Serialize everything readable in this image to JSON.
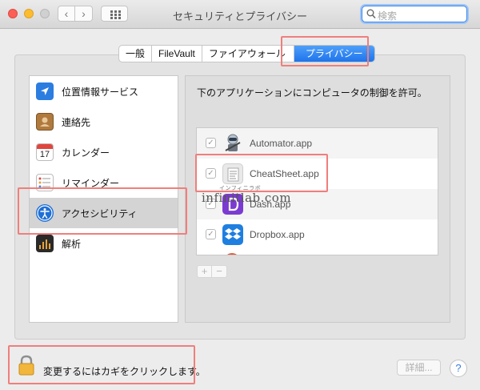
{
  "window": {
    "title": "セキュリティとプライバシー",
    "search_placeholder": "検索",
    "nav_back": "‹",
    "nav_forward": "›"
  },
  "tabs": [
    {
      "label": "一般",
      "active": false
    },
    {
      "label": "FileVault",
      "active": false
    },
    {
      "label": "ファイアウォール",
      "active": false
    },
    {
      "label": "プライバシー",
      "active": true
    }
  ],
  "sidebar": {
    "items": [
      {
        "label": "位置情報サービス",
        "icon": "location-arrow-icon",
        "selected": false
      },
      {
        "label": "連絡先",
        "icon": "contacts-book-icon",
        "selected": false
      },
      {
        "label": "カレンダー",
        "icon": "calendar-icon",
        "selected": false,
        "icon_day": "17"
      },
      {
        "label": "リマインダー",
        "icon": "reminders-icon",
        "selected": false
      },
      {
        "label": "アクセシビリティ",
        "icon": "accessibility-icon",
        "selected": true
      },
      {
        "label": "解析",
        "icon": "analytics-icon",
        "selected": false
      }
    ]
  },
  "main": {
    "description": "下のアプリケーションにコンピュータの制御を許可。",
    "apps": [
      {
        "name": "Automator.app",
        "checked": true,
        "icon": "automator-robot-icon"
      },
      {
        "name": "CheatSheet.app",
        "checked": true,
        "icon": "cheatsheet-icon"
      },
      {
        "name": "Dash.app",
        "checked": true,
        "icon": "dash-icon"
      },
      {
        "name": "Dropbox.app",
        "checked": true,
        "icon": "dropbox-icon"
      }
    ],
    "add_label": "+",
    "remove_label": "−",
    "checkmark": "✓"
  },
  "footer": {
    "lock_text": "変更するにはカギをクリックします。",
    "details_label": "詳細...",
    "help_label": "?"
  },
  "watermark": {
    "text": "infinitlab.com",
    "subtext": "インフィニラボ"
  },
  "colors": {
    "accent": "#2a7bec",
    "annotation": "#ef7f7c",
    "selected_row": "#d4d4d4"
  }
}
